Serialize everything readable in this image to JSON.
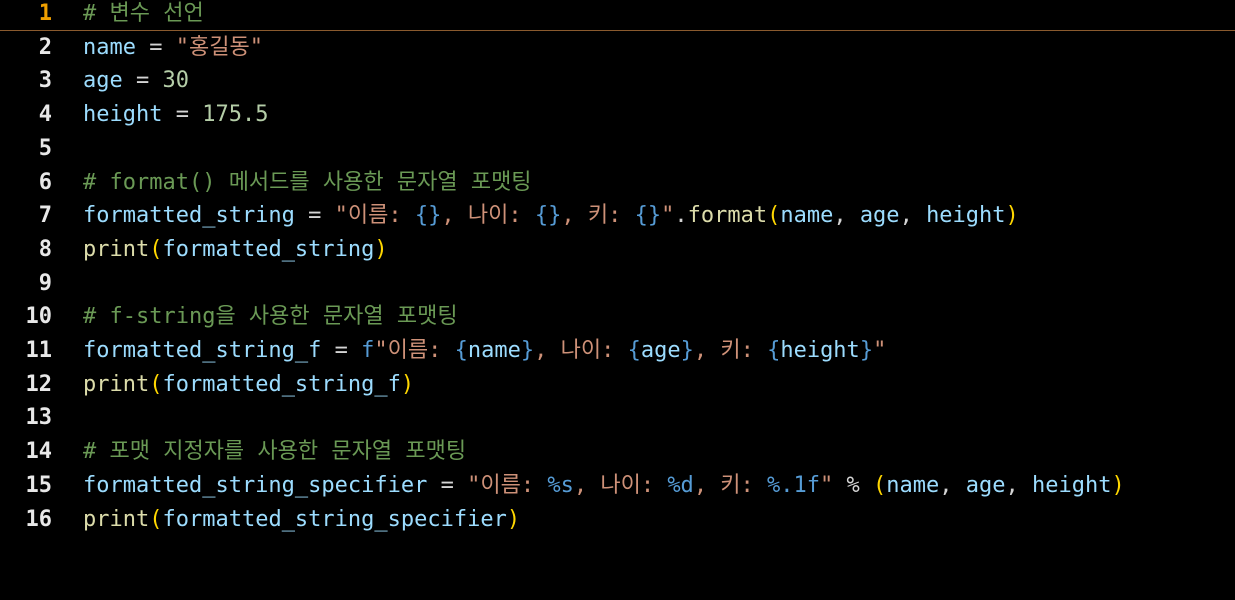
{
  "editor": {
    "current_line": 1,
    "lines": [
      {
        "no": "1",
        "code": "# 변수 선언"
      },
      {
        "no": "2",
        "code": "name = \"홍길동\""
      },
      {
        "no": "3",
        "code": "age = 30"
      },
      {
        "no": "4",
        "code": "height = 175.5"
      },
      {
        "no": "5",
        "code": ""
      },
      {
        "no": "6",
        "code": "# format() 메서드를 사용한 문자열 포맷팅"
      },
      {
        "no": "7",
        "code": "formatted_string = \"이름: {}, 나이: {}, 키: {}\".format(name, age, height)"
      },
      {
        "no": "8",
        "code": "print(formatted_string)"
      },
      {
        "no": "9",
        "code": ""
      },
      {
        "no": "10",
        "code": "# f-string을 사용한 문자열 포맷팅"
      },
      {
        "no": "11",
        "code": "formatted_string_f = f\"이름: {name}, 나이: {age}, 키: {height}\""
      },
      {
        "no": "12",
        "code": "print(formatted_string_f)"
      },
      {
        "no": "13",
        "code": ""
      },
      {
        "no": "14",
        "code": "# 포맷 지정자를 사용한 문자열 포맷팅"
      },
      {
        "no": "15",
        "code": "formatted_string_specifier = \"이름: %s, 나이: %d, 키: %.1f\" % (name, age, height)"
      },
      {
        "no": "16",
        "code": "print(formatted_string_specifier)"
      }
    ]
  }
}
